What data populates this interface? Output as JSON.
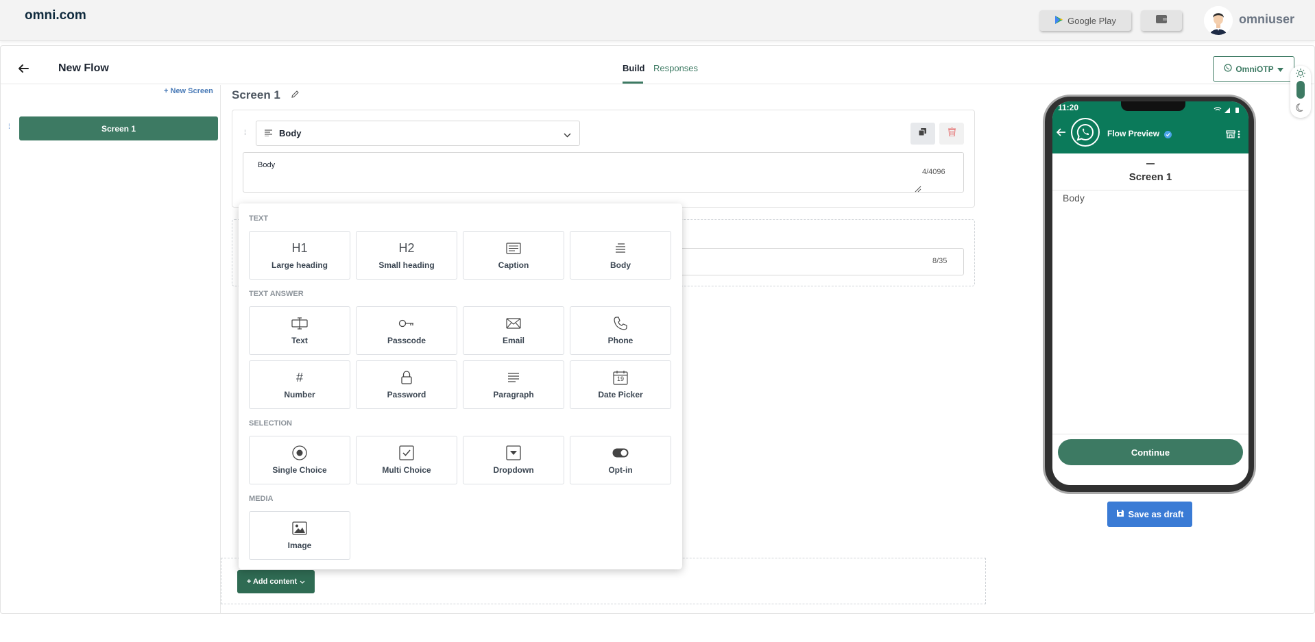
{
  "topbar": {
    "brand": "omni.com",
    "google_play_label": "Google Play",
    "username": "omniuser",
    "icons": [
      "google-play-icon",
      "wallet-icon",
      "avatar"
    ]
  },
  "header": {
    "title": "New Flow",
    "tabs": [
      {
        "label": "Build",
        "active": true
      },
      {
        "label": "Responses",
        "active": false
      }
    ],
    "account_label": "OmniOTP"
  },
  "sidebar": {
    "new_screen_label": "+ New Screen",
    "screens": [
      {
        "label": "Screen 1",
        "selected": true
      }
    ]
  },
  "editor": {
    "screen_title": "Screen 1",
    "component_type": "Body",
    "body_value": "Body",
    "body_counter": "4/4096",
    "second_counter": "8/35",
    "add_content_label": "+ Add content"
  },
  "content_menu": {
    "sections": [
      {
        "label": "TEXT",
        "items": [
          {
            "label": "Large heading",
            "icon": "H1"
          },
          {
            "label": "Small heading",
            "icon": "H2"
          },
          {
            "label": "Caption",
            "icon": "caption-icon"
          },
          {
            "label": "Body",
            "icon": "body-icon"
          }
        ]
      },
      {
        "label": "TEXT ANSWER",
        "items": [
          {
            "label": "Text",
            "icon": "text-input-icon"
          },
          {
            "label": "Passcode",
            "icon": "key-icon"
          },
          {
            "label": "Email",
            "icon": "envelope-icon"
          },
          {
            "label": "Phone",
            "icon": "phone-icon"
          },
          {
            "label": "Number",
            "icon": "#"
          },
          {
            "label": "Password",
            "icon": "lock-icon"
          },
          {
            "label": "Paragraph",
            "icon": "paragraph-icon"
          },
          {
            "label": "Date Picker",
            "icon": "calendar-icon",
            "icon_text": "19"
          }
        ]
      },
      {
        "label": "SELECTION",
        "items": [
          {
            "label": "Single Choice",
            "icon": "radio-icon"
          },
          {
            "label": "Multi Choice",
            "icon": "checkbox-icon"
          },
          {
            "label": "Dropdown",
            "icon": "dropdown-icon"
          },
          {
            "label": "Opt-in",
            "icon": "toggle-icon"
          }
        ]
      },
      {
        "label": "MEDIA",
        "items": [
          {
            "label": "Image",
            "icon": "image-icon"
          }
        ]
      }
    ]
  },
  "preview": {
    "status_time": "11:20",
    "header_title": "Flow Preview",
    "screen_title": "Screen 1",
    "body_text": "Body",
    "continue_label": "Continue",
    "save_draft_label": "Save as draft"
  },
  "colors": {
    "primary_green": "#3d7a63",
    "whatsapp_green": "#0b7a5a",
    "link_blue": "#4a7bb7",
    "save_blue": "#3a7bd5"
  }
}
